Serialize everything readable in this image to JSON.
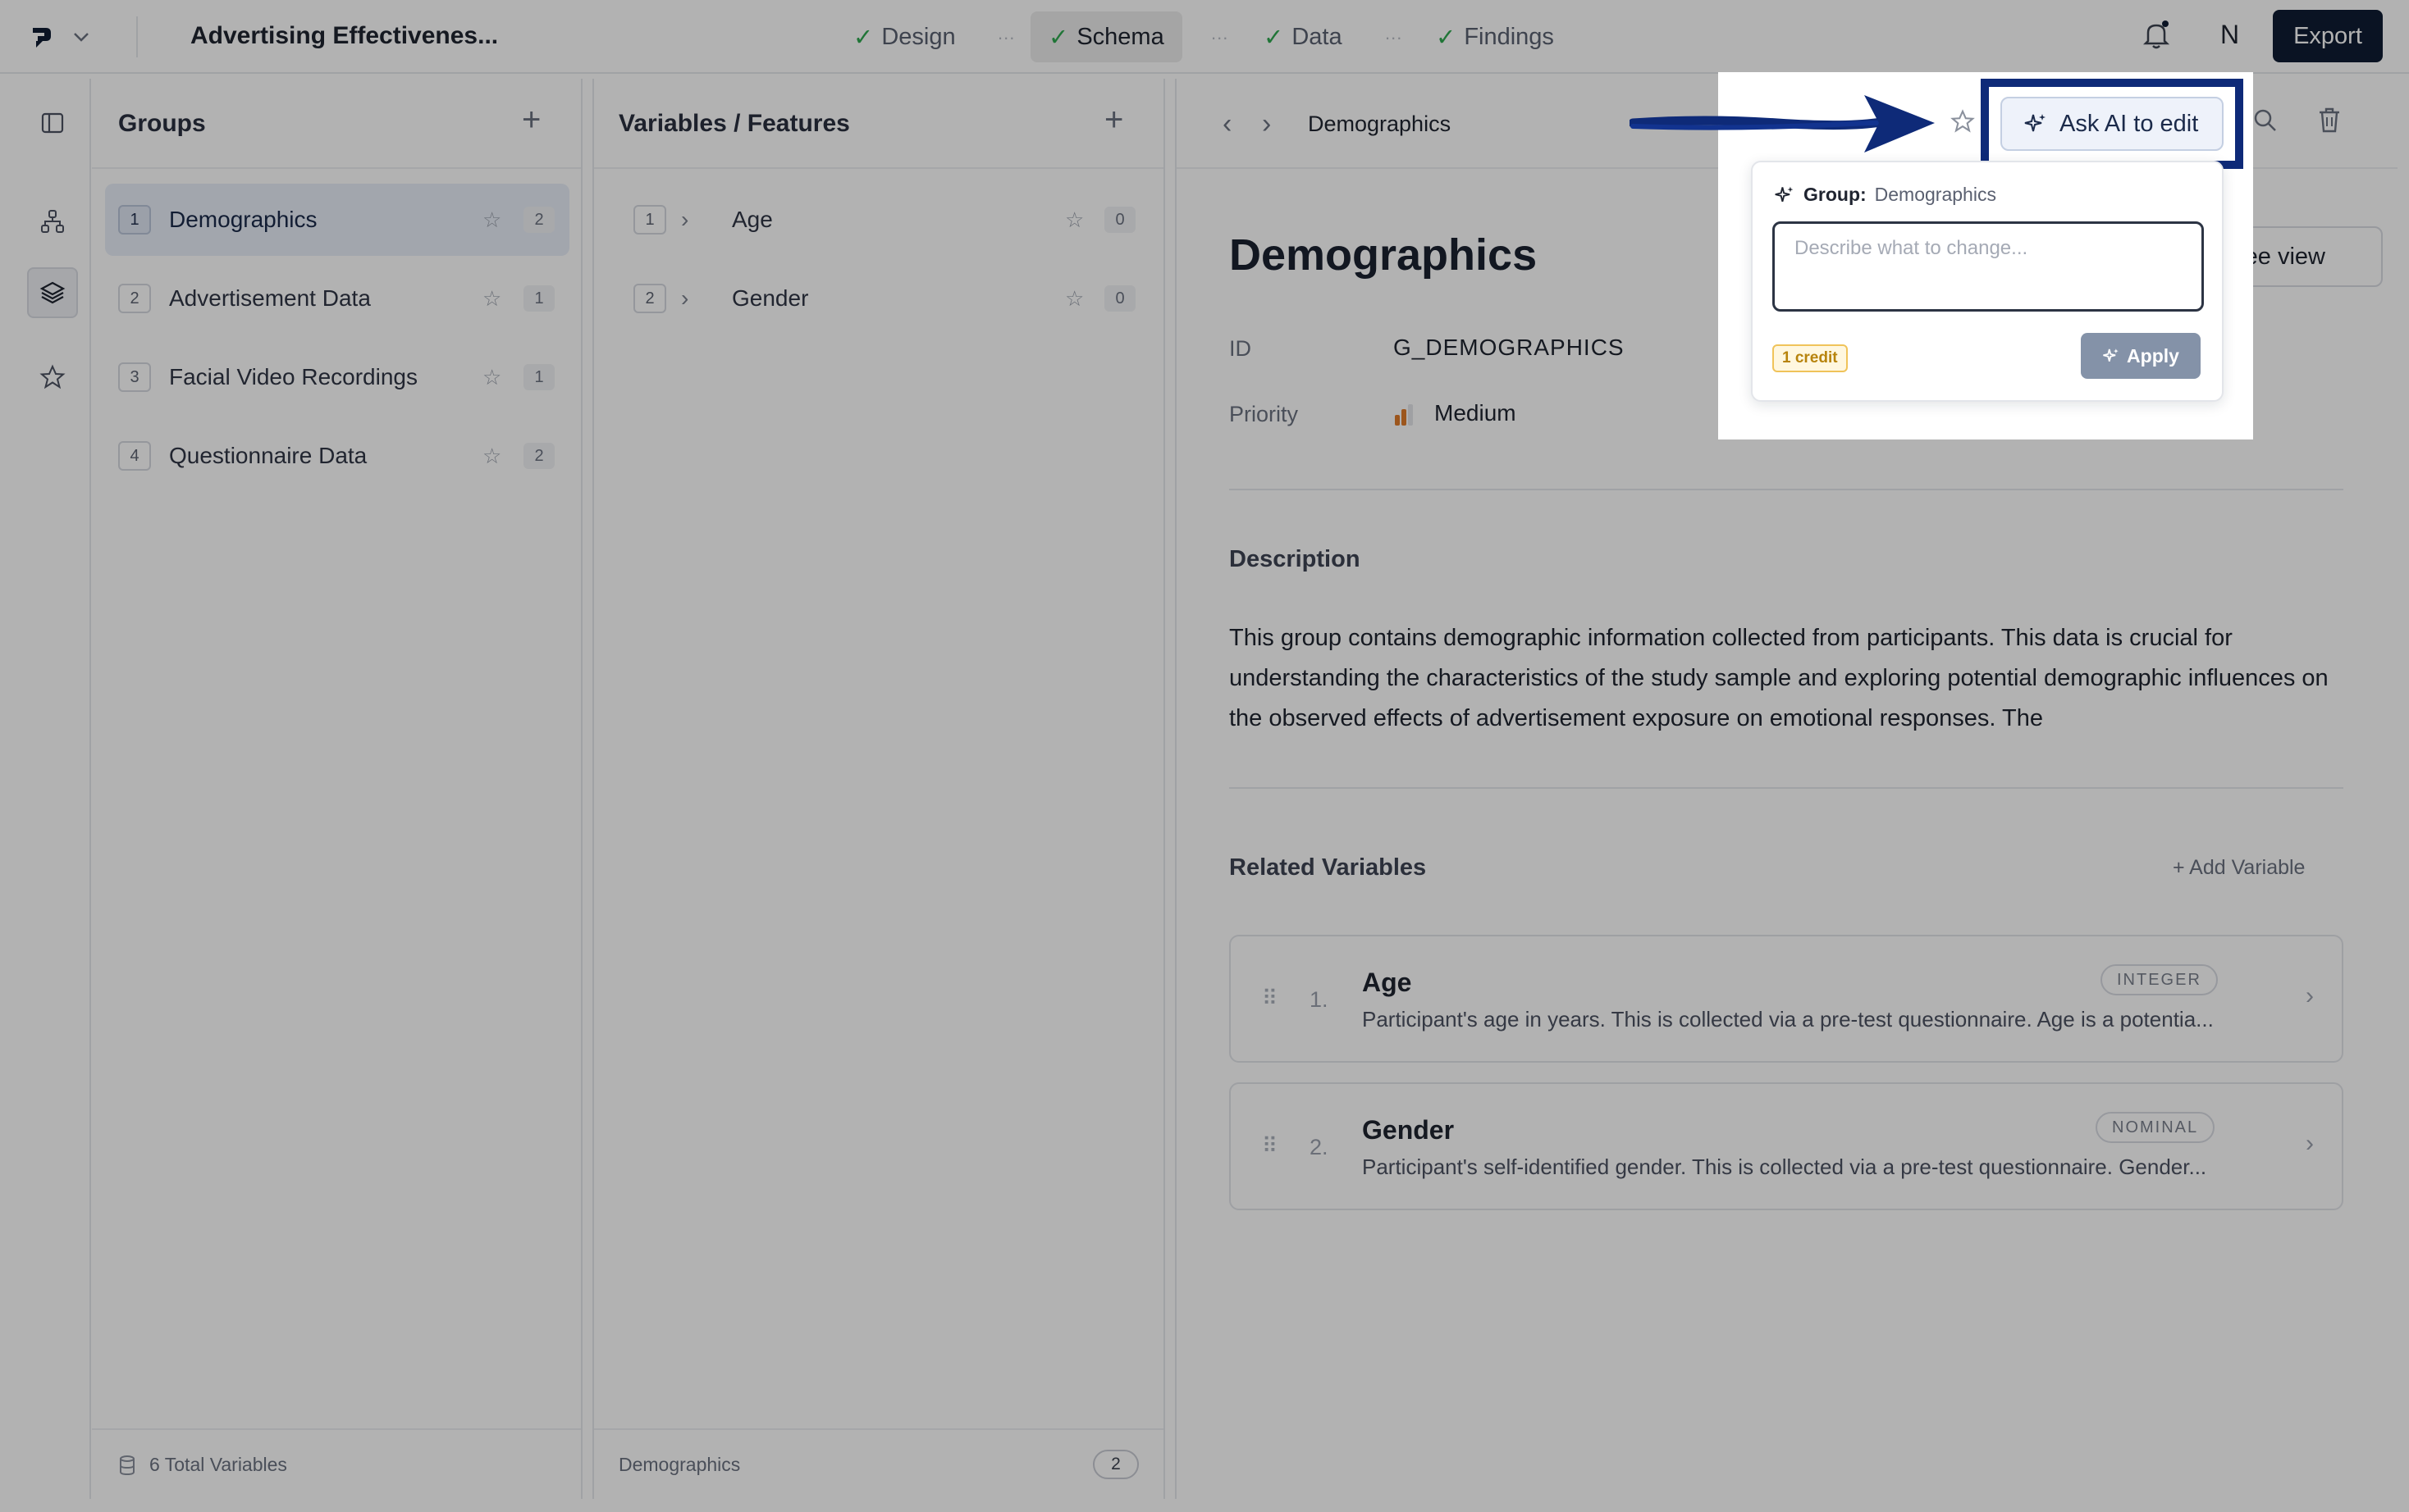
{
  "topbar": {
    "title": "Advertising Effectivenes...",
    "steps": [
      {
        "label": "Design"
      },
      {
        "label": "Schema"
      },
      {
        "label": "Data"
      },
      {
        "label": "Findings"
      }
    ],
    "separator": "...",
    "check": "✓",
    "user_initial": "N",
    "export_label": "Export"
  },
  "groups_panel": {
    "title": "Groups",
    "add": "+",
    "items": [
      {
        "index": "1",
        "label": "Demographics",
        "count": "2"
      },
      {
        "index": "2",
        "label": "Advertisement Data",
        "count": "1"
      },
      {
        "index": "3",
        "label": "Facial Video Recordings",
        "count": "1"
      },
      {
        "index": "4",
        "label": "Questionnaire Data",
        "count": "2"
      }
    ],
    "footer": "6 Total Variables"
  },
  "variables_panel": {
    "title": "Variables / Features",
    "add": "+",
    "items": [
      {
        "index": "1",
        "label": "Age",
        "count": "0"
      },
      {
        "index": "2",
        "label": "Gender",
        "count": "0"
      }
    ],
    "footer_label": "Demographics",
    "footer_count": "2"
  },
  "detail": {
    "breadcrumb": "Demographics",
    "heading": "Demographics",
    "tree_view_label": "ree view",
    "id_label": "ID",
    "id_value": "G_DEMOGRAPHICS",
    "priority_label": "Priority",
    "priority_value": "Medium",
    "description_title": "Description",
    "description": "This group contains demographic information collected from participants. This data is crucial for understanding the characteristics of the study sample and exploring potential demographic influences on the observed effects of advertisement exposure on emotional responses. The",
    "related_title": "Related Variables",
    "add_variable": "+ Add Variable",
    "related": [
      {
        "num": "1.",
        "name": "Age",
        "type": "INTEGER",
        "desc": "Participant's age in years. This is collected via a pre-test questionnaire. Age is a potentia..."
      },
      {
        "num": "2.",
        "name": "Gender",
        "type": "NOMINAL",
        "desc": "Participant's self-identified gender. This is collected via a pre-test questionnaire. Gender..."
      }
    ]
  },
  "ai_popover": {
    "button_label": "Ask AI to edit",
    "group_prefix": "Group:",
    "group_name": "Demographics",
    "placeholder": "Describe what to change...",
    "credit": "1 credit",
    "apply_label": "Apply"
  },
  "colors": {
    "brand_dark": "#0f1c33",
    "highlight": "#0e2a78",
    "check": "#2fa84f",
    "priority": "#e07b2a"
  }
}
